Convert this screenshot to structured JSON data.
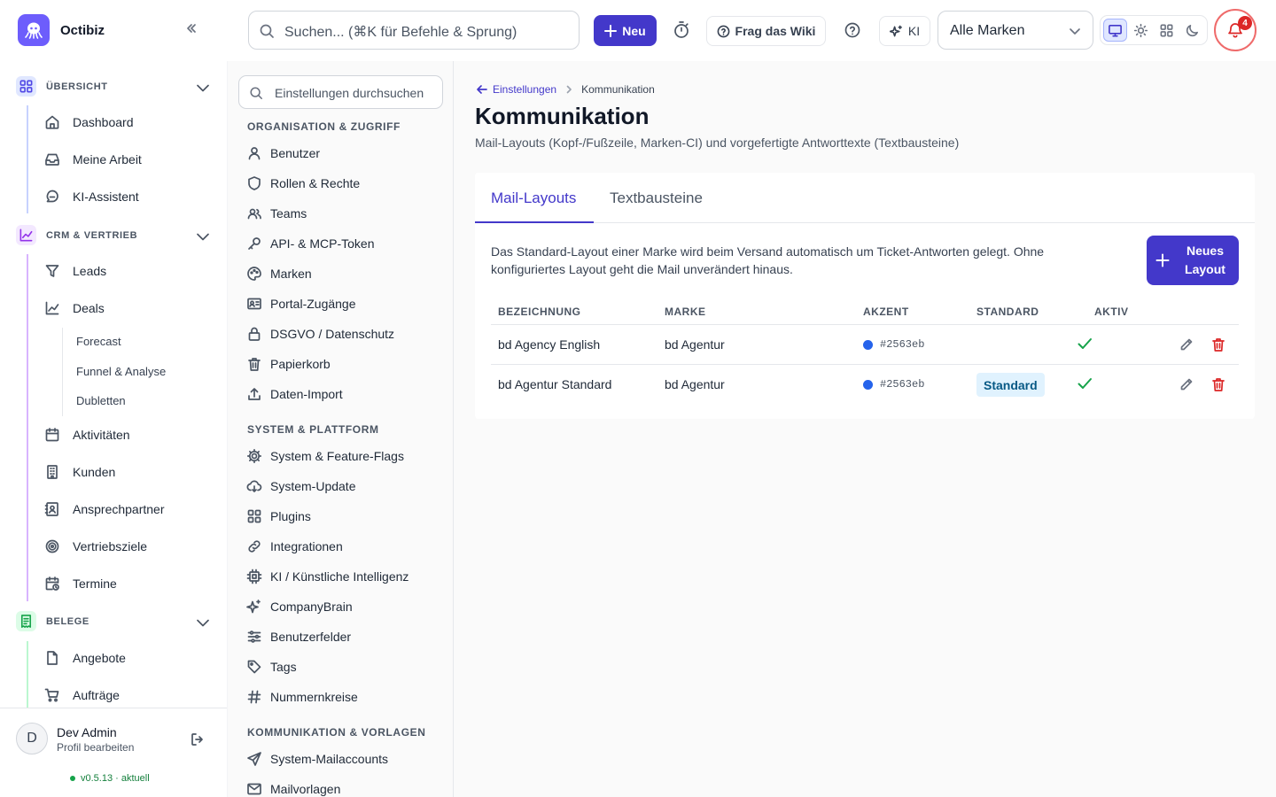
{
  "app": {
    "name": "Octibiz"
  },
  "topbar": {
    "search_placeholder": "Suchen... (⌘K für Befehle & Sprung)",
    "new_label": "Neu",
    "wiki_label": "Frag das Wiki",
    "ki_label": "KI",
    "brand_select": "Alle Marken",
    "notification_count": "4"
  },
  "sidebar": {
    "sections": [
      {
        "label": "ÜBERSICHT",
        "items": [
          "Dashboard",
          "Meine Arbeit",
          "KI-Assistent"
        ]
      },
      {
        "label": "CRM & VERTRIEB",
        "items": [
          "Leads",
          "Deals",
          "Aktivitäten",
          "Kunden",
          "Ansprechpartner",
          "Vertriebsziele",
          "Termine"
        ],
        "subitems": [
          "Forecast",
          "Funnel & Analyse",
          "Dubletten"
        ]
      },
      {
        "label": "BELEGE",
        "items": [
          "Angebote",
          "Aufträge"
        ]
      }
    ],
    "user": {
      "name": "Dev Admin",
      "sub": "Profil bearbeiten",
      "initial": "D",
      "version": "v0.5.13 · aktuell"
    }
  },
  "settings_nav": {
    "search_placeholder": "Einstellungen durchsuchen",
    "groups": [
      {
        "label": "ORGANISATION & ZUGRIFF",
        "items": [
          "Benutzer",
          "Rollen & Rechte",
          "Teams",
          "API- & MCP-Token",
          "Marken",
          "Portal-Zugänge",
          "DSGVO / Datenschutz",
          "Papierkorb",
          "Daten-Import"
        ]
      },
      {
        "label": "SYSTEM & PLATTFORM",
        "items": [
          "System & Feature-Flags",
          "System-Update",
          "Plugins",
          "Integrationen",
          "KI / Künstliche Intelligenz",
          "CompanyBrain",
          "Benutzerfelder",
          "Tags",
          "Nummernkreise"
        ]
      },
      {
        "label": "KOMMUNIKATION & VORLAGEN",
        "items": [
          "System-Mailaccounts",
          "Mailvorlagen"
        ]
      }
    ]
  },
  "main": {
    "breadcrumb_back": "Einstellungen",
    "breadcrumb_current": "Kommunikation",
    "title": "Kommunikation",
    "description": "Mail-Layouts (Kopf-/Fußzeile, Marken-CI) und vorgefertigte Antworttexte (Textbausteine)",
    "tabs": [
      "Mail-Layouts",
      "Textbausteine"
    ],
    "intro": "Das Standard-Layout einer Marke wird beim Versand automatisch um Ticket-Antworten gelegt. Ohne konfiguriertes Layout geht die Mail unverändert hinaus.",
    "new_layout_label": "Neues Layout",
    "table": {
      "columns": [
        "BEZEICHNUNG",
        "MARKE",
        "AKZENT",
        "STANDARD",
        "AKTIV"
      ],
      "rows": [
        {
          "name": "bd Agency English",
          "brand": "bd Agentur",
          "accent": "#2563eb",
          "standard": "",
          "active": true
        },
        {
          "name": "bd Agentur Standard",
          "brand": "bd Agentur",
          "accent": "#2563eb",
          "standard": "Standard",
          "active": true
        }
      ]
    }
  },
  "colors": {
    "primary": "#4338ca",
    "accent_dot": "#2563eb",
    "success": "#16a34a",
    "danger": "#dc2626"
  }
}
